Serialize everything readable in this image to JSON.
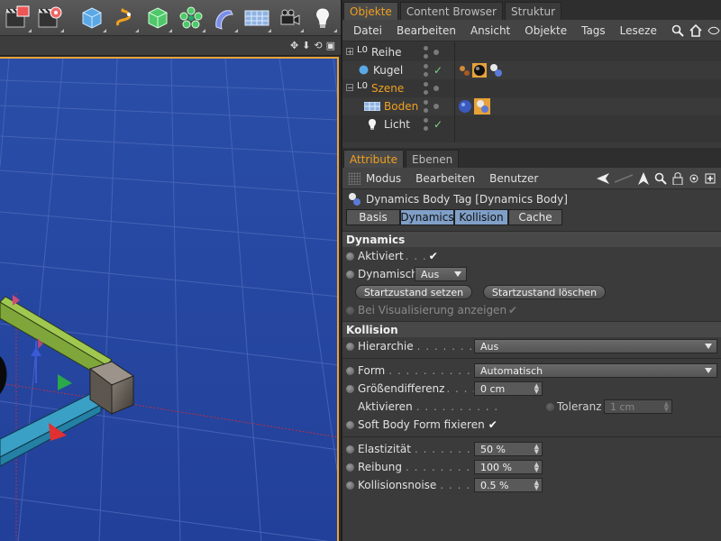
{
  "object_manager": {
    "tabs": [
      "Objekte",
      "Content Browser",
      "Struktur"
    ],
    "menu": [
      "Datei",
      "Bearbeiten",
      "Ansicht",
      "Objekte",
      "Tags",
      "Leseze"
    ],
    "objects": [
      {
        "name": "Reihe",
        "selected": false
      },
      {
        "name": "Kugel",
        "selected": false
      },
      {
        "name": "Szene",
        "selected": true
      },
      {
        "name": "Boden",
        "selected": true
      },
      {
        "name": "Licht",
        "selected": false
      }
    ],
    "null_glyph": "L0"
  },
  "attribute_manager": {
    "tabs": [
      "Attribute",
      "Ebenen"
    ],
    "menu": [
      "Modus",
      "Bearbeiten",
      "Benutzer"
    ],
    "title": "Dynamics Body Tag [Dynamics Body]",
    "subtabs": [
      "Basis",
      "Dynamics",
      "Kollision",
      "Cache"
    ],
    "dynamics": {
      "header": "Dynamics",
      "aktiviert_label": "Aktiviert",
      "aktiviert_dots": ". . .",
      "dynamisch_label": "Dynamisch",
      "dynamisch_value": "Aus",
      "btn_set": "Startzustand setzen",
      "btn_clear": "Startzustand löschen",
      "visual_label": "Bei Visualisierung anzeigen"
    },
    "kollision": {
      "header": "Kollision",
      "hierarchie_label": "Hierarchie",
      "hierarchie_dots": ". . . . . . . . . . . .",
      "hierarchie_value": "Aus",
      "form_label": "Form",
      "form_dots": ". . . . . . . . . . . . . . . .",
      "form_value": "Automatisch",
      "groesse_label": "Größendifferenz",
      "groesse_dots": ". . . . .",
      "groesse_value": "0 cm",
      "aktivieren_label": "Aktivieren",
      "aktivieren_dots": ". . . . . . . . . .",
      "toleranz_label": "Toleranz",
      "toleranz_value": "1 cm",
      "softbody_label": "Soft Body Form fixieren",
      "elast_label": "Elastizität",
      "elast_dots": ". . . . . . . . . . . .",
      "elast_value": "50 %",
      "reibung_label": "Reibung",
      "reibung_dots": ". . . . . . . . . . . . .",
      "reibung_value": "100 %",
      "noise_label": "Kollisionsnoise",
      "noise_dots": ". . . . . . .",
      "noise_value": "0.5 %"
    }
  },
  "colors": {
    "accent": "#f0a020",
    "subtab_active": "#7f9fc7",
    "viewport_border": "#e8a23a"
  }
}
